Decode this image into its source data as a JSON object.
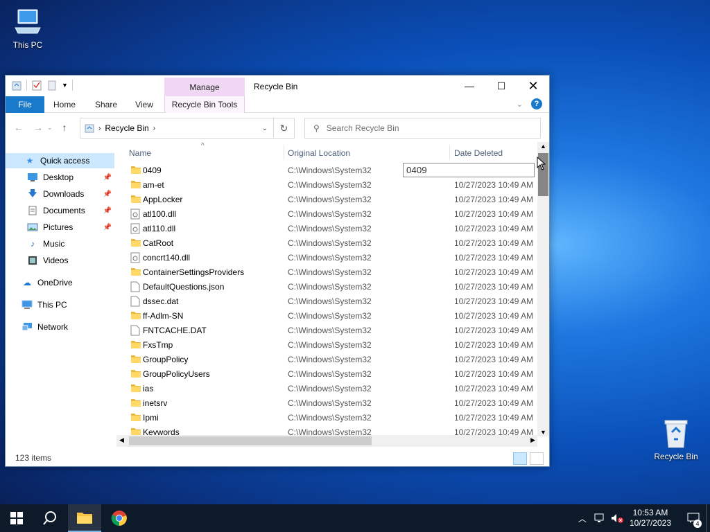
{
  "desktop": {
    "this_pc": "This PC",
    "recycle_bin": "Recycle Bin"
  },
  "window": {
    "title": "Recycle Bin",
    "manage_tab": "Manage",
    "tabs": {
      "file": "File",
      "home": "Home",
      "share": "Share",
      "view": "View",
      "tools": "Recycle Bin Tools"
    },
    "address": {
      "path": "Recycle Bin"
    },
    "search": {
      "placeholder": "Search Recycle Bin"
    },
    "nav": {
      "quick_access": "Quick access",
      "desktop": "Desktop",
      "downloads": "Downloads",
      "documents": "Documents",
      "pictures": "Pictures",
      "music": "Music",
      "videos": "Videos",
      "onedrive": "OneDrive",
      "this_pc": "This PC",
      "network": "Network"
    },
    "columns": {
      "name": "Name",
      "location": "Original Location",
      "date": "Date Deleted"
    },
    "rename_value": "0409",
    "files": [
      {
        "name": "0409",
        "type": "folder",
        "location": "C:\\Windows\\System32",
        "date": ""
      },
      {
        "name": "am-et",
        "type": "folder",
        "location": "C:\\Windows\\System32",
        "date": "10/27/2023 10:49 AM"
      },
      {
        "name": "AppLocker",
        "type": "folder",
        "location": "C:\\Windows\\System32",
        "date": "10/27/2023 10:49 AM"
      },
      {
        "name": "atl100.dll",
        "type": "dll",
        "location": "C:\\Windows\\System32",
        "date": "10/27/2023 10:49 AM"
      },
      {
        "name": "atl110.dll",
        "type": "dll",
        "location": "C:\\Windows\\System32",
        "date": "10/27/2023 10:49 AM"
      },
      {
        "name": "CatRoot",
        "type": "folder",
        "location": "C:\\Windows\\System32",
        "date": "10/27/2023 10:49 AM"
      },
      {
        "name": "concrt140.dll",
        "type": "dll",
        "location": "C:\\Windows\\System32",
        "date": "10/27/2023 10:49 AM"
      },
      {
        "name": "ContainerSettingsProviders",
        "type": "folder",
        "location": "C:\\Windows\\System32",
        "date": "10/27/2023 10:49 AM"
      },
      {
        "name": "DefaultQuestions.json",
        "type": "file",
        "location": "C:\\Windows\\System32",
        "date": "10/27/2023 10:49 AM"
      },
      {
        "name": "dssec.dat",
        "type": "file",
        "location": "C:\\Windows\\System32",
        "date": "10/27/2023 10:49 AM"
      },
      {
        "name": "ff-Adlm-SN",
        "type": "folder",
        "location": "C:\\Windows\\System32",
        "date": "10/27/2023 10:49 AM"
      },
      {
        "name": "FNTCACHE.DAT",
        "type": "file",
        "location": "C:\\Windows\\System32",
        "date": "10/27/2023 10:49 AM"
      },
      {
        "name": "FxsTmp",
        "type": "folder",
        "location": "C:\\Windows\\System32",
        "date": "10/27/2023 10:49 AM"
      },
      {
        "name": "GroupPolicy",
        "type": "folder",
        "location": "C:\\Windows\\System32",
        "date": "10/27/2023 10:49 AM"
      },
      {
        "name": "GroupPolicyUsers",
        "type": "folder",
        "location": "C:\\Windows\\System32",
        "date": "10/27/2023 10:49 AM"
      },
      {
        "name": "ias",
        "type": "folder",
        "location": "C:\\Windows\\System32",
        "date": "10/27/2023 10:49 AM"
      },
      {
        "name": "inetsrv",
        "type": "folder",
        "location": "C:\\Windows\\System32",
        "date": "10/27/2023 10:49 AM"
      },
      {
        "name": "Ipmi",
        "type": "folder",
        "location": "C:\\Windows\\System32",
        "date": "10/27/2023 10:49 AM"
      },
      {
        "name": "Keywords",
        "type": "folder",
        "location": "C:\\Windows\\System32",
        "date": "10/27/2023 10:49 AM"
      }
    ],
    "status": {
      "count": "123 items"
    }
  },
  "taskbar": {
    "time": "10:53 AM",
    "date": "10/27/2023",
    "notifications": "4"
  }
}
